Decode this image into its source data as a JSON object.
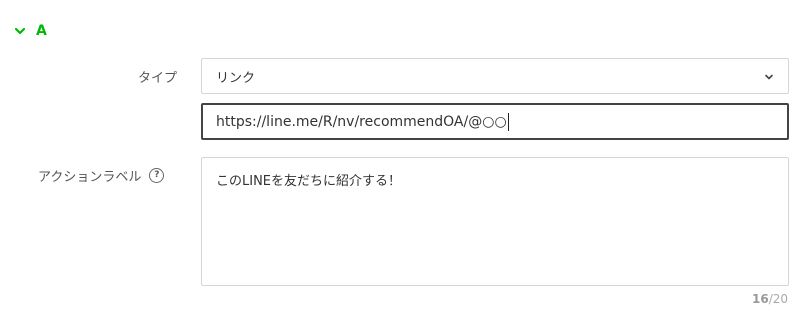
{
  "section": {
    "title": "A",
    "expand_icon": "chevron-down-icon",
    "accent_color": "#00b900"
  },
  "type_field": {
    "label": "タイプ",
    "selected_value": "リンク",
    "caret_icon": "chevron-down-icon"
  },
  "url_field": {
    "value": "https://line.me/R/nv/recommendOA/@○○"
  },
  "action_label_field": {
    "label": "アクションラベル",
    "help_icon": "question-circle-icon",
    "help_glyph": "?",
    "value": "このLINEを友だちに紹介する！",
    "counter_current": "16",
    "counter_max": "/20"
  }
}
